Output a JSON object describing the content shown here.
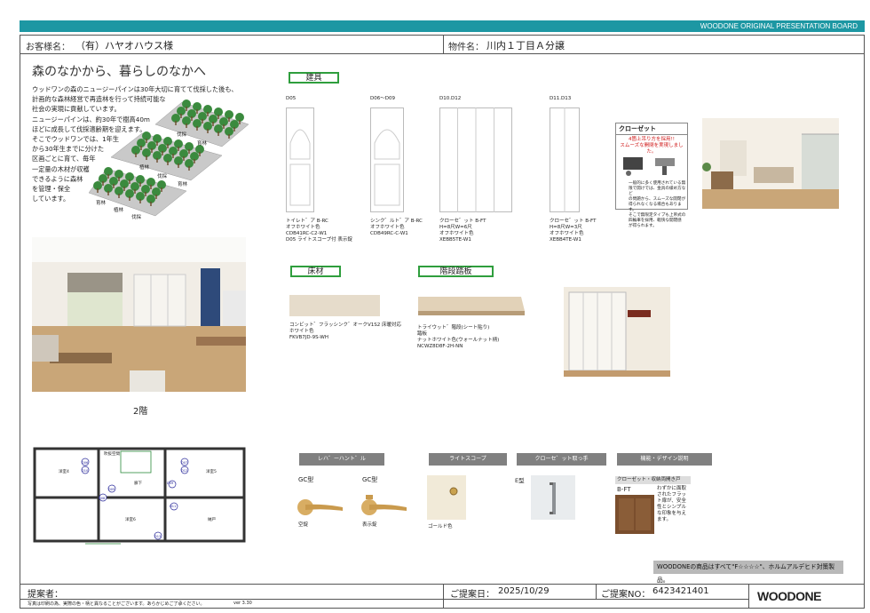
{
  "topbar_title": "WOODONE ORIGINAL PRESENTATION BOARD",
  "header": {
    "customer_label": "お客様名：",
    "customer_name": "（有）ハヤオハウス様",
    "property_label": "物件名：",
    "property_name": "川内１丁目Ａ分譲"
  },
  "intro": {
    "heading": "森のなかから、暮らしのなかへ",
    "lines": [
      "ウッドワンの森のニュージーパインは30年大切に育てて伐採した後も、",
      "計画的な森林経営で再造林を行って持続可能な",
      "社会の実現に貢献しています。",
      "ニュージーパインは、約30年で樹高40m",
      "ほどに成長して伐採適齢期を迎えます。",
      "そこでウッドワンでは、1年生",
      "から30年生までに分けた",
      "区画ごとに育て、毎年",
      "一定量の木材が収穫",
      "できるように森林",
      "を管理・保全",
      "しています。"
    ],
    "forest_labels": [
      "伐採",
      "育林",
      "植林",
      "伐採",
      "育林",
      "育林",
      "植林",
      "伐採"
    ]
  },
  "photo_caption": "2階",
  "sections": {
    "doors_title": "建具",
    "floor_title": "床材",
    "stairs_title": "階段踏板"
  },
  "doors": [
    {
      "code": "D05",
      "desc": [
        "トイレト゛ア B-RC",
        "オフホワイト色",
        "CDB41RC-C2-W1",
        "D05 ライトスコープ付 表示錠"
      ]
    },
    {
      "code": "D06～D09",
      "desc": [
        "シンク゛ルト゛ア B-RC",
        "オフホワイト色",
        "CDB49RC-C-W1"
      ]
    },
    {
      "code": "D10.D12",
      "desc": [
        "クローセ゛ット B-FT",
        "H=8尺W=6尺",
        "オフホワイト色",
        "XEBB5TE-W1"
      ]
    },
    {
      "code": "D11.D13",
      "desc": [
        "クローセ゛ット B-FT",
        "H=8尺W=3尺",
        "オフホワイト色",
        "XEBB4TE-W1"
      ]
    }
  ],
  "closet_promo": {
    "title": "クローゼット",
    "red_text": [
      "4箇上吊り方を採用!!",
      "スムーズな開閉を実現しました。"
    ],
    "body": [
      "一般的に多く使用されている無",
      "限で開けでは、金具の緩め方など",
      "の問題から、スムーズな開閉が",
      "得られなくなる場合もあります。",
      "そこで無限定タイプも上吊式の",
      "四輪車を採用、軽快な開閉感",
      "が得られます。"
    ]
  },
  "floor": {
    "desc": [
      "コンビット゛フラッシンク゛オークV1S2 床暖対応",
      "ホワイト色",
      "FKVB7JD-9S-WH"
    ]
  },
  "stairs": {
    "desc": [
      "トライウット゛階段(シート貼り)",
      "踏板",
      "ナットホワイト色(ウォールナット柄)",
      "NCWZ8D8F-2H-NN"
    ]
  },
  "hardware_headers": [
    "レハ゛ーハント゛ル",
    "ライトスコープ",
    "クローセ゛ット取っ手",
    "機能・デザイン説明"
  ],
  "handles": [
    {
      "type": "GC型",
      "caption": "空錠"
    },
    {
      "type": "GC型",
      "caption": "表示錠"
    }
  ],
  "light_scope_caption": "ゴールド色",
  "pull_type": "E型",
  "feature": {
    "title": "クローゼット・収納両開き戸",
    "code": "B-FT",
    "text": [
      "わずかに面取",
      "されたフラッ",
      "ト扉が、安全",
      "性とシンプル",
      "な印象を与え",
      "ます。"
    ]
  },
  "floorplan_labels": [
    "洋室4",
    "廊下",
    "洋室5",
    "洋室6",
    "納戸",
    "D05",
    "D06",
    "D07",
    "D08",
    "D09",
    "D10",
    "D11",
    "D12",
    "D13",
    "吹抜空間"
  ],
  "notice": "WOODONEの商品はすべて\"F☆☆☆☆\"、ホルムアルデヒド対策製品。",
  "footer": {
    "proposer_label": "提案者：",
    "disclaimer": "写真は印刷の為、実際の色・柄と異なることがございます。あらかじめご了承ください。",
    "version": "ver 3.30",
    "date_label": "ご提案日：",
    "date_value": "2025/10/29",
    "no_label": "ご提案NO：",
    "no_value": "6423421401",
    "logo": "WOODONE"
  },
  "colors": {
    "teal": "#1d97a3",
    "green": "#2f9e3d",
    "wood": "#c9a678",
    "gray": "#808080"
  }
}
